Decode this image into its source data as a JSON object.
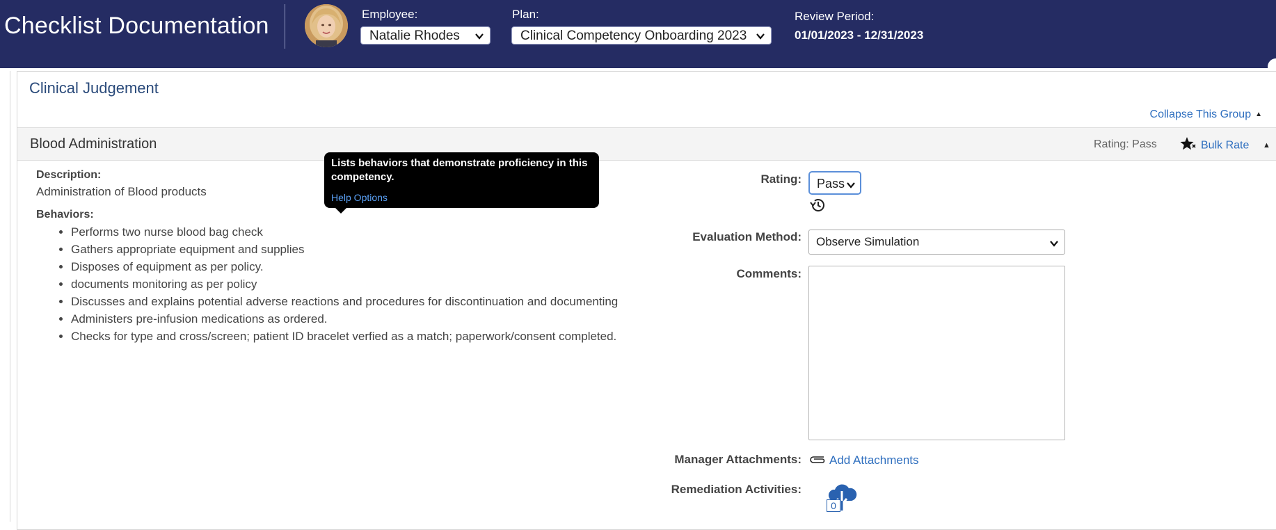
{
  "header": {
    "title": "Checklist Documentation",
    "employee_label": "Employee:",
    "employee_value": "Natalie Rhodes",
    "plan_label": "Plan:",
    "plan_value": "Clinical Competency Onboarding 2023",
    "review_label": "Review Period:",
    "review_value": "01/01/2023 - 12/31/2023"
  },
  "group": {
    "title": "Clinical Judgement",
    "collapse_label": "Collapse This Group"
  },
  "competency": {
    "title": "Blood Administration",
    "rating_summary": "Rating: Pass",
    "bulk_rate_label": "Bulk Rate",
    "description_label": "Description:",
    "description_text": "Administration of Blood products",
    "behaviors_label": "Behaviors:",
    "behaviors": [
      "Performs two nurse blood bag check",
      "Gathers appropriate equipment and supplies",
      "Disposes of equipment as per policy.",
      "documents monitoring as per policy",
      "Discusses and explains potential adverse reactions and procedures for discontinuation and documenting",
      "Administers pre-infusion medications as ordered.",
      "Checks for type and cross/screen; patient ID bracelet verfied as a match; paperwork/consent completed."
    ]
  },
  "tooltip": {
    "text": "Lists behaviors that demonstrate proficiency in this competency.",
    "link": "Help Options"
  },
  "form": {
    "rating_label": "Rating:",
    "rating_value": "Pass",
    "method_label": "Evaluation Method:",
    "method_value": "Observe Simulation",
    "comments_label": "Comments:",
    "comments_value": "",
    "attachments_label": "Manager Attachments:",
    "attachments_link": "Add Attachments",
    "remediation_label": "Remediation Activities:",
    "remediation_count": "0"
  },
  "icons": {
    "chevron": "chevron-down-icon",
    "star": "star-icon",
    "history": "history-icon",
    "paperclip": "paperclip-icon",
    "remediation": "cloud-download-icon"
  },
  "colors": {
    "header_bg": "#252c63",
    "link": "#2f6fbf",
    "tooltip_bg": "#000000",
    "remediation_icon": "#2a62b0"
  }
}
